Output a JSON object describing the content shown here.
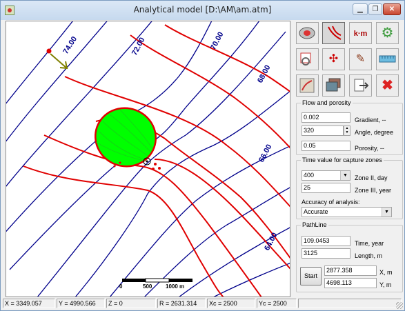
{
  "window": {
    "title": "Analytical model  [D:\\AM\\am.atm]"
  },
  "titlebar_buttons": {
    "minimize": "▁",
    "restore": "❐",
    "close": "✕"
  },
  "map": {
    "contour_labels": [
      "74.00",
      "72.00",
      "70.00",
      "68.00",
      "66.00",
      "64.00"
    ],
    "scale_labels": [
      "0",
      "500",
      "1000 m"
    ],
    "colors": {
      "contour": "#00008b",
      "streamline": "#e00000",
      "capture_zone": "#00ff00",
      "arrow": "#808000"
    }
  },
  "statusbar": {
    "x": "X = 3349.057",
    "y": "Y = 4990.566",
    "z": "Z = 0",
    "r": "R = 2631.314",
    "xc": "Xc = 2500",
    "yc": "Yc = 2500"
  },
  "toolbar": {
    "icons": [
      "model-icon",
      "flowlines-icon",
      "km-icon",
      "settings-gear-icon",
      "select-area-icon",
      "shrink-icon",
      "brush-icon",
      "ruler-icon",
      "layer-icon",
      "images-icon",
      "export-icon",
      "delete-icon"
    ],
    "km_label": "k·m"
  },
  "flow": {
    "title": "Flow and porosity",
    "gradient_value": "0.002",
    "gradient_label": "Gradient, --",
    "angle_value": "320",
    "angle_label": "Angle, degree",
    "porosity_value": "0.05",
    "porosity_label": "Porosity, --"
  },
  "capture": {
    "title": "Time value for capture zones",
    "zone2_value": "400",
    "zone2_label": "Zone II, day",
    "zone3_value": "25",
    "zone3_label": "Zone III, year",
    "accuracy_label": "Accuracy of analysis:",
    "accuracy_value": "Accurate"
  },
  "pathline": {
    "title": "PathLine",
    "time_value": "109.0453",
    "time_label": "Time, year",
    "length_value": "3125",
    "length_label": "Length, m",
    "start_label": "Start",
    "x_value": "2877.358",
    "x_label": "X, m",
    "y_value": "4698.113",
    "y_label": "Y, m"
  }
}
